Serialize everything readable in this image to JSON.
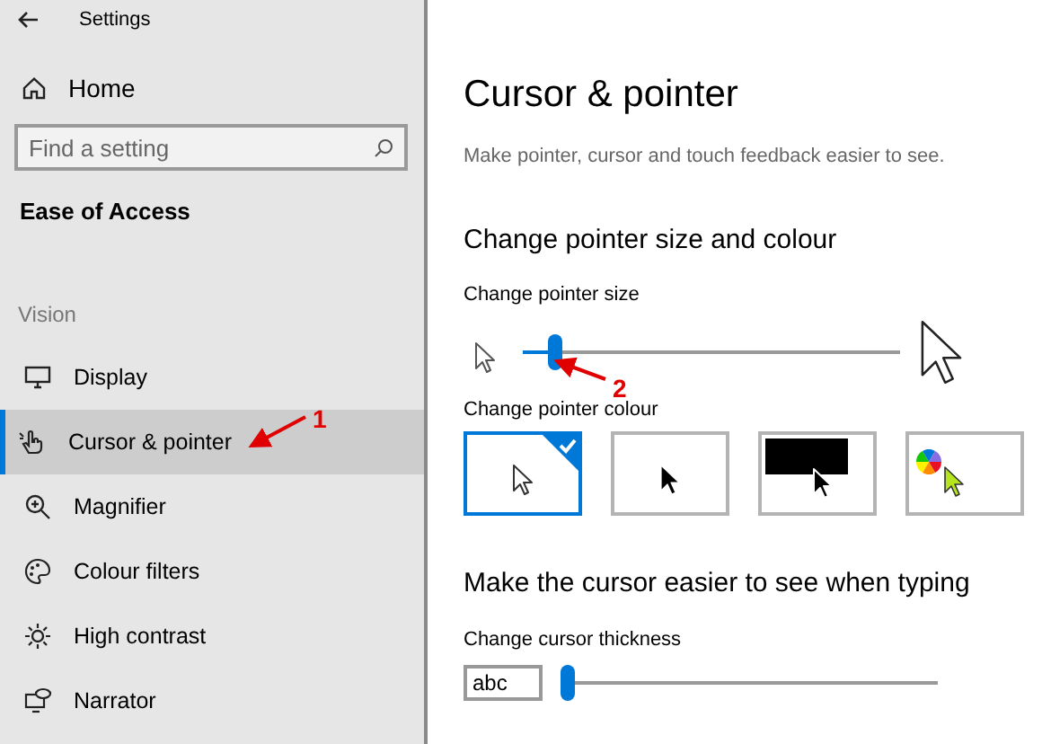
{
  "window": {
    "title": "Settings"
  },
  "sidebar": {
    "home": "Home",
    "search": {
      "placeholder": "Find a setting"
    },
    "section": "Ease of Access",
    "group": "Vision",
    "items": [
      {
        "label": "Display",
        "selected": false
      },
      {
        "label": "Cursor & pointer",
        "selected": true
      },
      {
        "label": "Magnifier",
        "selected": false
      },
      {
        "label": "Colour filters",
        "selected": false
      },
      {
        "label": "High contrast",
        "selected": false
      },
      {
        "label": "Narrator",
        "selected": false
      }
    ]
  },
  "page": {
    "title": "Cursor & pointer",
    "description": "Make pointer, cursor and touch feedback easier to see.",
    "pointer_heading": "Change pointer size and colour",
    "size_label": "Change pointer size",
    "size_slider": {
      "level": 0.07
    },
    "colour_label": "Change pointer colour",
    "colour_tiles": [
      {
        "kind": "white",
        "selected": true
      },
      {
        "kind": "black",
        "selected": false
      },
      {
        "kind": "inverted",
        "selected": false
      },
      {
        "kind": "custom",
        "selected": false
      }
    ],
    "typing_heading": "Make the cursor easier to see when typing",
    "thickness_label": "Change cursor thickness",
    "thickness_preview": "abc",
    "thickness_slider": {
      "level": 0
    }
  },
  "annotations": [
    {
      "label": "1"
    },
    {
      "label": "2"
    }
  ]
}
